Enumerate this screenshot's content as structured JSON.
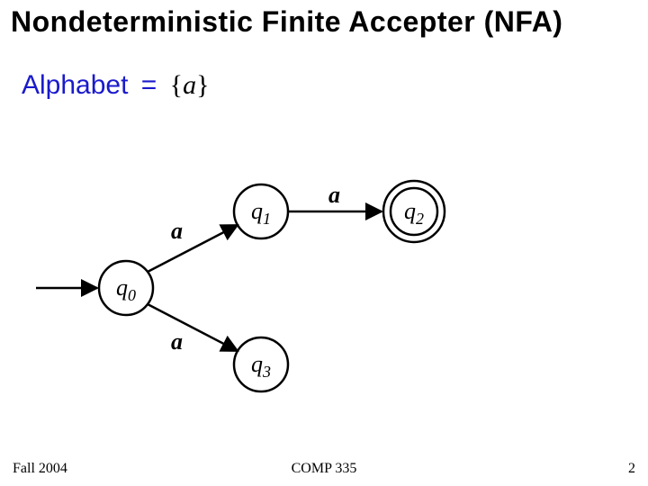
{
  "title": "Nondeterministic Finite Accepter (NFA)",
  "alphabet": {
    "label": "Alphabet",
    "equals": "=",
    "set_open": "{",
    "symbol": "a",
    "set_close": "}"
  },
  "automaton": {
    "states": {
      "q0": {
        "label": "q",
        "sub": "0",
        "accepting": false,
        "initial": true
      },
      "q1": {
        "label": "q",
        "sub": "1",
        "accepting": false,
        "initial": false
      },
      "q2": {
        "label": "q",
        "sub": "2",
        "accepting": true,
        "initial": false
      },
      "q3": {
        "label": "q",
        "sub": "3",
        "accepting": false,
        "initial": false
      }
    },
    "transitions": [
      {
        "from": "q0",
        "to": "q1",
        "label": "a"
      },
      {
        "from": "q0",
        "to": "q3",
        "label": "a"
      },
      {
        "from": "q1",
        "to": "q2",
        "label": "a"
      }
    ]
  },
  "footer": {
    "left": "Fall 2004",
    "center": "COMP 335",
    "right": "2"
  }
}
